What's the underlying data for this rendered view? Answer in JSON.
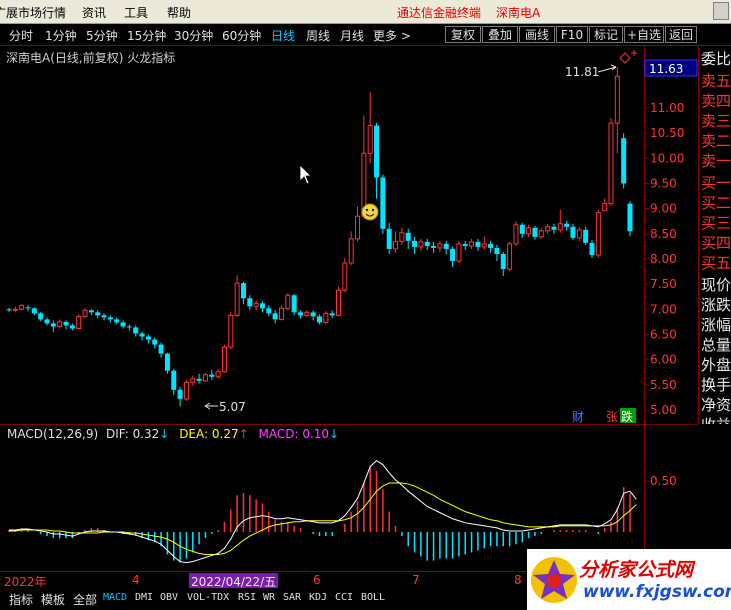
{
  "menubar": {
    "items": [
      "广展市场行情",
      "资讯",
      "工具",
      "帮助"
    ],
    "app_title": "通达信金融终端",
    "stock_title": "深南电A"
  },
  "period_bar": {
    "periods": [
      "分时",
      "1分钟",
      "5分钟",
      "15分钟",
      "30分钟",
      "60分钟",
      "日线",
      "周线",
      "月线",
      "更多 >"
    ],
    "active_period": "日线",
    "buttons": [
      "复权",
      "叠加",
      "画线",
      "F10",
      "标记",
      "+自选",
      "返回"
    ]
  },
  "chart_info": "深南电A(日线,前复权) 火龙指标",
  "price_axis": {
    "current_price": "11.63",
    "ticks": [
      "11.00",
      "10.50",
      "10.00",
      "9.50",
      "9.00",
      "8.50",
      "8.00",
      "7.50",
      "7.00",
      "6.50",
      "6.00",
      "5.50",
      "5.00"
    ]
  },
  "annotations": {
    "high_label": "11.81",
    "low_label": "5.07",
    "markers": [
      "财",
      "张",
      "跌"
    ]
  },
  "right_panel": {
    "items": [
      "委比",
      "卖五",
      "卖四",
      "卖三",
      "卖二",
      "卖一",
      "买一",
      "买二",
      "买三",
      "买四",
      "买五",
      "现价",
      "涨跌",
      "涨幅",
      "总量",
      "外盘",
      "换手",
      "净资",
      "收益"
    ]
  },
  "macd_legend": {
    "name": "MACD(12,26,9)",
    "dif": "DIF: 0.32",
    "dea": "DEA: 0.27",
    "macd": "MACD: 0.10",
    "dif_arrow": "↓",
    "dea_arrow": "↑",
    "macd_arrow": "↓"
  },
  "macd_axis": {
    "tick": "0.50"
  },
  "time_axis": {
    "labels": [
      "2022年",
      "4",
      "2022/04/22/五",
      "6",
      "7",
      "8"
    ]
  },
  "bottom_tabs": {
    "items": [
      "指标",
      "模板",
      "全部",
      "MACD",
      "DMI",
      "OBV",
      "VOL-TDX",
      "RSI",
      "WR",
      "SAR",
      "KDJ",
      "CCI",
      "BOLL"
    ],
    "selected": "MACD"
  },
  "watermark": {
    "text": "分析家公式网",
    "url": "www.fxjgsw.com"
  },
  "colors": {
    "up": "#ff3232",
    "down": "#00e5ff",
    "dif_line": "#ffffff",
    "dea_line": "#ffff00",
    "macd_label": "#ff40ff",
    "axis": "#800000"
  },
  "chart_data": [
    {
      "type": "candlestick",
      "title": "深南电A(日线,前复权) 火龙指标",
      "ylim": [
        4.8,
        11.9
      ],
      "y_ticks": [
        5.0,
        5.5,
        6.0,
        6.5,
        7.0,
        7.5,
        8.0,
        8.5,
        9.0,
        9.5,
        10.0,
        10.5,
        11.0
      ],
      "candles": [
        [
          7.0,
          6.98,
          7.03,
          6.95
        ],
        [
          6.98,
          7.0,
          7.05,
          6.94
        ],
        [
          7.0,
          7.08,
          7.1,
          6.98
        ],
        [
          7.04,
          7.02,
          7.08,
          6.96
        ],
        [
          7.02,
          6.92,
          7.04,
          6.88
        ],
        [
          6.92,
          6.8,
          6.95,
          6.76
        ],
        [
          6.8,
          6.72,
          6.84,
          6.68
        ],
        [
          6.72,
          6.66,
          6.78,
          6.55
        ],
        [
          6.66,
          6.75,
          6.8,
          6.62
        ],
        [
          6.75,
          6.68,
          6.78,
          6.6
        ],
        [
          6.68,
          6.62,
          6.72,
          6.58
        ],
        [
          6.62,
          6.86,
          6.9,
          6.6
        ],
        [
          6.86,
          6.98,
          7.02,
          6.82
        ],
        [
          6.98,
          6.94,
          7.0,
          6.88
        ],
        [
          6.94,
          6.88,
          6.98,
          6.82
        ],
        [
          6.88,
          6.84,
          6.92,
          6.78
        ],
        [
          6.84,
          6.8,
          6.88,
          6.74
        ],
        [
          6.8,
          6.74,
          6.84,
          6.7
        ],
        [
          6.74,
          6.66,
          6.78,
          6.62
        ],
        [
          6.66,
          6.64,
          6.7,
          6.58
        ],
        [
          6.64,
          6.52,
          6.68,
          6.46
        ],
        [
          6.52,
          6.46,
          6.56,
          6.38
        ],
        [
          6.46,
          6.4,
          6.5,
          6.32
        ],
        [
          6.4,
          6.3,
          6.44,
          6.22
        ],
        [
          6.3,
          6.12,
          6.34,
          6.04
        ],
        [
          6.12,
          5.78,
          6.14,
          5.72
        ],
        [
          5.78,
          5.4,
          5.82,
          5.3
        ],
        [
          5.4,
          5.22,
          5.46,
          5.07
        ],
        [
          5.22,
          5.55,
          5.6,
          5.18
        ],
        [
          5.55,
          5.62,
          5.68,
          5.48
        ],
        [
          5.62,
          5.58,
          5.72,
          5.52
        ],
        [
          5.58,
          5.7,
          5.74,
          5.56
        ],
        [
          5.7,
          5.66,
          5.8,
          5.6
        ],
        [
          5.66,
          5.76,
          5.82,
          5.62
        ],
        [
          5.76,
          6.25,
          6.3,
          5.74
        ],
        [
          6.25,
          6.88,
          6.95,
          6.2
        ],
        [
          6.88,
          7.52,
          7.68,
          6.85
        ],
        [
          7.52,
          7.22,
          7.55,
          7.1
        ],
        [
          7.22,
          7.06,
          7.28,
          6.98
        ],
        [
          7.06,
          7.12,
          7.18,
          6.98
        ],
        [
          7.12,
          7.02,
          7.16,
          6.94
        ],
        [
          7.02,
          6.92,
          7.08,
          6.86
        ],
        [
          6.92,
          6.8,
          6.98,
          6.72
        ],
        [
          6.8,
          7.02,
          7.08,
          6.78
        ],
        [
          7.02,
          7.28,
          7.32,
          6.98
        ],
        [
          7.28,
          6.94,
          7.3,
          6.88
        ],
        [
          6.94,
          6.88,
          6.98,
          6.82
        ],
        [
          6.88,
          6.94,
          6.98,
          6.84
        ],
        [
          6.94,
          6.86,
          6.98,
          6.78
        ],
        [
          6.86,
          6.74,
          6.9,
          6.7
        ],
        [
          6.74,
          6.92,
          6.96,
          6.7
        ],
        [
          6.92,
          6.88,
          6.98,
          6.82
        ],
        [
          6.88,
          7.38,
          7.45,
          6.86
        ],
        [
          7.38,
          7.92,
          8.02,
          7.34
        ],
        [
          7.92,
          8.4,
          8.55,
          7.88
        ],
        [
          8.4,
          8.85,
          9.05,
          8.35
        ],
        [
          8.85,
          10.1,
          10.85,
          8.8
        ],
        [
          10.1,
          10.65,
          11.32,
          9.9
        ],
        [
          10.65,
          9.62,
          10.7,
          9.2
        ],
        [
          9.62,
          8.6,
          9.68,
          8.5
        ],
        [
          8.6,
          8.2,
          8.72,
          8.1
        ],
        [
          8.2,
          8.35,
          8.55,
          8.12
        ],
        [
          8.35,
          8.52,
          8.62,
          8.28
        ],
        [
          8.52,
          8.36,
          8.6,
          8.2
        ],
        [
          8.36,
          8.24,
          8.44,
          8.1
        ],
        [
          8.24,
          8.34,
          8.4,
          8.16
        ],
        [
          8.34,
          8.26,
          8.4,
          8.18
        ],
        [
          8.26,
          8.22,
          8.34,
          8.12
        ],
        [
          8.22,
          8.3,
          8.36,
          8.14
        ],
        [
          8.3,
          8.2,
          8.36,
          8.1
        ],
        [
          8.2,
          7.96,
          8.24,
          7.84
        ],
        [
          7.96,
          8.3,
          8.36,
          7.92
        ],
        [
          8.3,
          8.26,
          8.36,
          8.18
        ],
        [
          8.26,
          8.34,
          8.4,
          8.2
        ],
        [
          8.34,
          8.24,
          8.4,
          8.16
        ],
        [
          8.24,
          8.3,
          8.44,
          8.18
        ],
        [
          8.3,
          8.22,
          8.36,
          8.12
        ],
        [
          8.22,
          8.1,
          8.28,
          7.96
        ],
        [
          8.1,
          7.8,
          8.14,
          7.66
        ],
        [
          7.8,
          8.3,
          8.34,
          7.76
        ],
        [
          8.3,
          8.68,
          8.75,
          8.26
        ],
        [
          8.68,
          8.5,
          8.72,
          8.42
        ],
        [
          8.5,
          8.62,
          8.68,
          8.44
        ],
        [
          8.62,
          8.44,
          8.66,
          8.38
        ],
        [
          8.44,
          8.56,
          8.62,
          8.4
        ],
        [
          8.56,
          8.64,
          8.7,
          8.5
        ],
        [
          8.64,
          8.58,
          8.7,
          8.5
        ],
        [
          8.58,
          8.7,
          8.98,
          8.52
        ],
        [
          8.7,
          8.64,
          8.76,
          8.56
        ],
        [
          8.64,
          8.42,
          8.7,
          8.38
        ],
        [
          8.42,
          8.58,
          8.64,
          8.36
        ],
        [
          8.58,
          8.32,
          8.64,
          8.28
        ],
        [
          8.32,
          8.08,
          8.38,
          8.02
        ],
        [
          8.08,
          8.92,
          8.98,
          8.02
        ],
        [
          8.96,
          9.1,
          9.2,
          8.95
        ],
        [
          9.1,
          10.7,
          10.8,
          9.05
        ],
        [
          10.7,
          11.63,
          11.81,
          10.1
        ],
        [
          10.4,
          9.5,
          10.5,
          9.4
        ],
        [
          9.1,
          8.55,
          9.15,
          8.45
        ]
      ]
    },
    {
      "type": "line",
      "title": "MACD(12,26,9)",
      "y_ticks": [
        0.5
      ],
      "series": [
        {
          "name": "DIF",
          "values": [
            0.02,
            0.02,
            0.03,
            0.03,
            0.02,
            0.01,
            0.0,
            -0.02,
            -0.02,
            -0.03,
            -0.04,
            -0.02,
            0.0,
            0.01,
            0.01,
            0.01,
            0.0,
            0.0,
            -0.01,
            -0.02,
            -0.03,
            -0.05,
            -0.07,
            -0.09,
            -0.12,
            -0.18,
            -0.24,
            -0.29,
            -0.3,
            -0.29,
            -0.27,
            -0.25,
            -0.23,
            -0.21,
            -0.16,
            -0.07,
            0.05,
            0.11,
            0.14,
            0.15,
            0.16,
            0.15,
            0.13,
            0.13,
            0.14,
            0.13,
            0.12,
            0.11,
            0.1,
            0.09,
            0.09,
            0.09,
            0.11,
            0.16,
            0.24,
            0.33,
            0.48,
            0.64,
            0.7,
            0.66,
            0.58,
            0.51,
            0.46,
            0.4,
            0.35,
            0.3,
            0.25,
            0.22,
            0.19,
            0.16,
            0.13,
            0.11,
            0.09,
            0.08,
            0.07,
            0.06,
            0.05,
            0.04,
            0.02,
            0.01,
            0.01,
            0.01,
            0.02,
            0.03,
            0.04,
            0.05,
            0.06,
            0.07,
            0.07,
            0.07,
            0.07,
            0.07,
            0.06,
            0.05,
            0.08,
            0.12,
            0.22,
            0.38,
            0.4,
            0.32
          ]
        },
        {
          "name": "DEA",
          "values": [
            0.01,
            0.01,
            0.02,
            0.02,
            0.02,
            0.02,
            0.02,
            0.01,
            0.01,
            0.0,
            -0.01,
            -0.01,
            -0.01,
            -0.01,
            -0.01,
            0.0,
            0.0,
            0.0,
            0.0,
            -0.01,
            -0.01,
            -0.02,
            -0.03,
            -0.04,
            -0.05,
            -0.07,
            -0.1,
            -0.14,
            -0.17,
            -0.19,
            -0.21,
            -0.22,
            -0.22,
            -0.22,
            -0.21,
            -0.18,
            -0.13,
            -0.08,
            -0.04,
            -0.01,
            0.02,
            0.05,
            0.07,
            0.08,
            0.09,
            0.1,
            0.1,
            0.11,
            0.11,
            0.11,
            0.11,
            0.11,
            0.11,
            0.12,
            0.14,
            0.18,
            0.24,
            0.32,
            0.4,
            0.45,
            0.48,
            0.48,
            0.48,
            0.47,
            0.45,
            0.42,
            0.39,
            0.36,
            0.32,
            0.29,
            0.26,
            0.23,
            0.2,
            0.18,
            0.16,
            0.14,
            0.12,
            0.11,
            0.09,
            0.08,
            0.07,
            0.06,
            0.05,
            0.05,
            0.05,
            0.05,
            0.05,
            0.06,
            0.06,
            0.06,
            0.06,
            0.06,
            0.06,
            0.06,
            0.06,
            0.07,
            0.1,
            0.16,
            0.21,
            0.27
          ]
        }
      ]
    }
  ]
}
